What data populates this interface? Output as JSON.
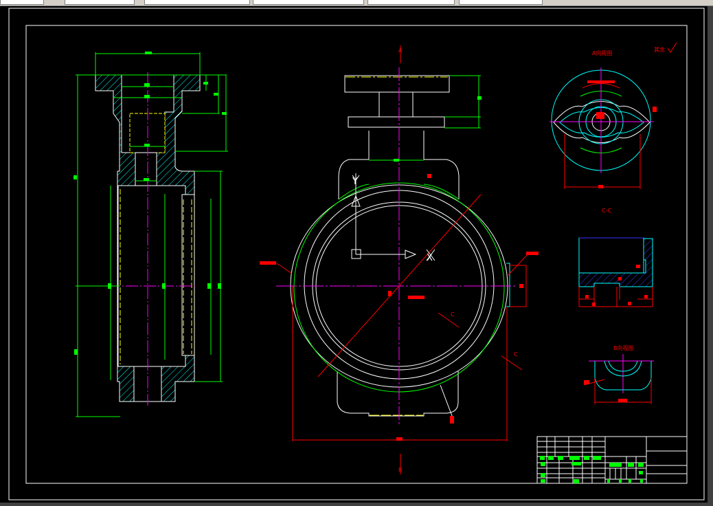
{
  "drawing": {
    "view_a_title": "A向视图",
    "surface_note": "其余",
    "section_cc_title": "C-C",
    "view_b_title": "B向视图",
    "section_mark_top": "A",
    "section_mark_bottom": "B",
    "section_mark_c1": "C",
    "section_mark_c2": "C",
    "ucs_x": "X",
    "ucs_y": "Y"
  },
  "colors": {
    "background": "#000000",
    "outline": "#ffffff",
    "dimension": "#00ff00",
    "centerline": "#ff00ff",
    "annotation": "#ff0000",
    "hatch": "#00ffff",
    "hidden": "#ffff00"
  }
}
